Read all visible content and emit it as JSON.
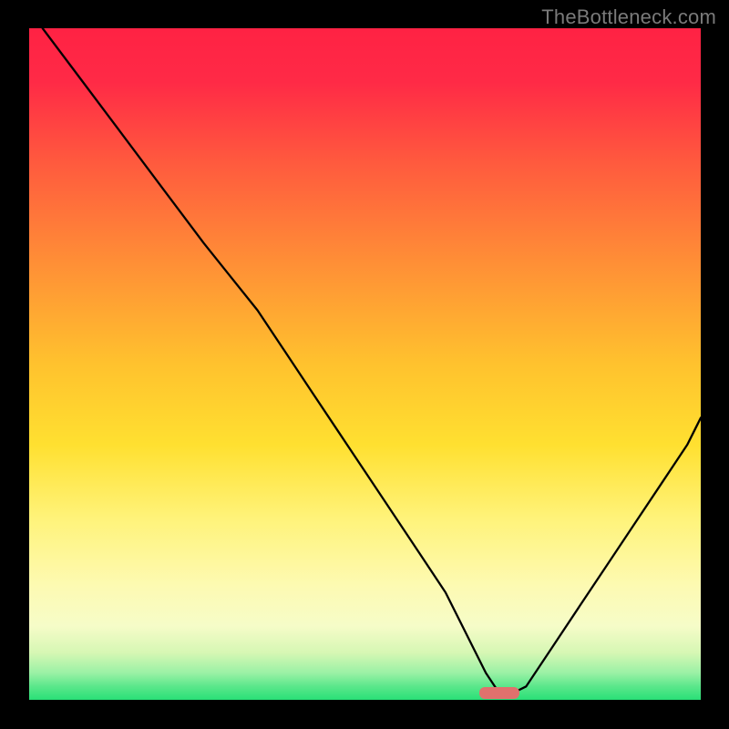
{
  "watermark": "TheBottleneck.com",
  "chart_data": {
    "type": "line",
    "title": "",
    "xlabel": "",
    "ylabel": "",
    "xlim": [
      0,
      100
    ],
    "ylim": [
      0,
      100
    ],
    "series": [
      {
        "name": "bottleneck-curve",
        "x": [
          2,
          8,
          14,
          20,
          26,
          30,
          34,
          38,
          42,
          46,
          50,
          54,
          58,
          62,
          66,
          68,
          70,
          72,
          74,
          78,
          82,
          86,
          90,
          94,
          98,
          100
        ],
        "y": [
          100,
          92,
          84,
          76,
          68,
          63,
          58,
          52,
          46,
          40,
          34,
          28,
          22,
          16,
          8,
          4,
          1,
          1,
          2,
          8,
          14,
          20,
          26,
          32,
          38,
          42
        ]
      }
    ],
    "marker": {
      "name": "optimal-badge",
      "x_center": 70,
      "y": 1,
      "gradient_stops": [
        {
          "pos": 0.0,
          "color": "#ff2244"
        },
        {
          "pos": 0.25,
          "color": "#ff6a3a"
        },
        {
          "pos": 0.5,
          "color": "#ffd02a"
        },
        {
          "pos": 0.73,
          "color": "#fff37a"
        },
        {
          "pos": 0.85,
          "color": "#fdfcc0"
        },
        {
          "pos": 0.93,
          "color": "#d6f7b4"
        },
        {
          "pos": 0.97,
          "color": "#86eca0"
        },
        {
          "pos": 1.0,
          "color": "#29e077"
        }
      ]
    }
  }
}
